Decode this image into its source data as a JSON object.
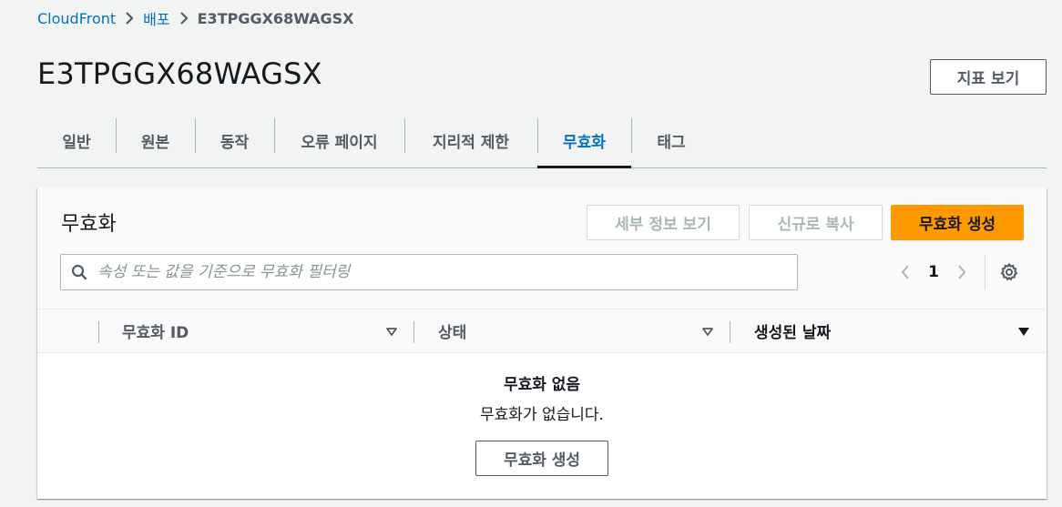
{
  "breadcrumb": {
    "items": [
      "CloudFront",
      "배포"
    ],
    "current": "E3TPGGX68WAGSX"
  },
  "page": {
    "title": "E3TPGGX68WAGSX",
    "metrics_button": "지표 보기"
  },
  "tabs": [
    {
      "label": "일반",
      "active": false
    },
    {
      "label": "원본",
      "active": false
    },
    {
      "label": "동작",
      "active": false
    },
    {
      "label": "오류 페이지",
      "active": false
    },
    {
      "label": "지리적 제한",
      "active": false
    },
    {
      "label": "무효화",
      "active": true
    },
    {
      "label": "태그",
      "active": false
    }
  ],
  "panel": {
    "title": "무효화",
    "view_details_button": "세부 정보 보기",
    "copy_to_new_button": "신규로 복사",
    "create_button": "무효화 생성",
    "search_placeholder": "속성 또는 값을 기준으로 무효화 필터링",
    "page_number": "1",
    "columns": [
      "무효화 ID",
      "상태",
      "생성된 날짜"
    ],
    "empty_title": "무효화 없음",
    "empty_description": "무효화가 없습니다.",
    "empty_create_button": "무효화 생성"
  },
  "colors": {
    "link": "#0073bb",
    "primary_button": "#ff9900",
    "active_tab": "#0073bb"
  }
}
